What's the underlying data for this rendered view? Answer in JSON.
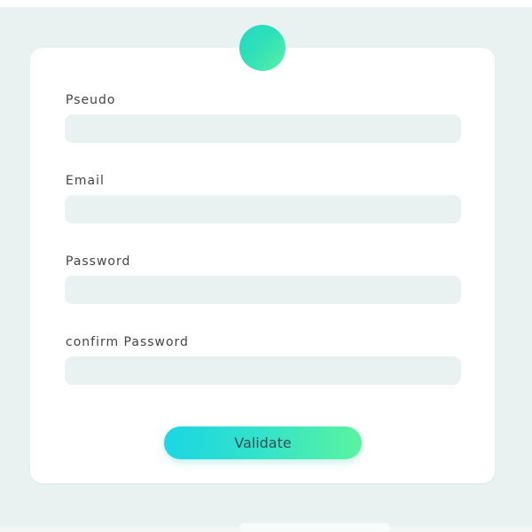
{
  "form": {
    "fields": [
      {
        "label": "Pseudo",
        "value": "",
        "placeholder": ""
      },
      {
        "label": "Email",
        "value": "",
        "placeholder": ""
      },
      {
        "label": "Password",
        "value": "",
        "placeholder": ""
      },
      {
        "label": "confirm Password",
        "value": "",
        "placeholder": ""
      }
    ],
    "submit_label": "Validate"
  },
  "icons": {
    "avatar": "avatar-circle-icon"
  },
  "colors": {
    "background": "#e9f2f1",
    "card": "#ffffff",
    "input_background": "#e9f2f1",
    "accent_start": "#1bd6e4",
    "accent_end": "#5af39f",
    "label_text": "#444444"
  }
}
